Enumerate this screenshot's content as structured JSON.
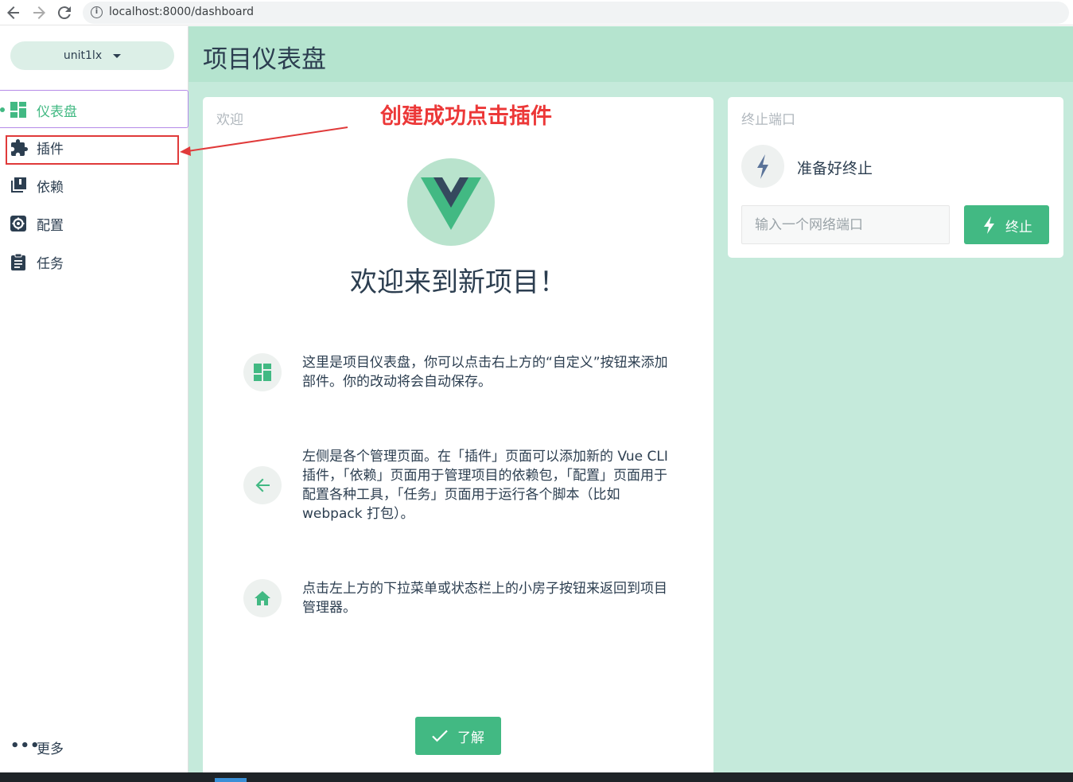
{
  "browser": {
    "url": "localhost:8000/dashboard",
    "back_icon": "arrow-left-icon",
    "forward_icon": "arrow-right-icon",
    "reload_icon": "reload-icon"
  },
  "sidebar": {
    "project_name": "unit1lx",
    "items": [
      {
        "label": "仪表盘",
        "icon": "dashboard-icon",
        "active": true
      },
      {
        "label": "插件",
        "icon": "puzzle-icon"
      },
      {
        "label": "依赖",
        "icon": "books-icon"
      },
      {
        "label": "配置",
        "icon": "gear-icon"
      },
      {
        "label": "任务",
        "icon": "clipboard-icon"
      }
    ],
    "more_label": "更多"
  },
  "header": {
    "title": "项目仪表盘"
  },
  "welcome": {
    "card_title": "欢迎",
    "heading": "欢迎来到新项目！",
    "tips": [
      {
        "icon": "dashboard-icon",
        "text": "这里是项目仪表盘，你可以点击右上方的“自定义”按钮来添加部件。你的改动将会自动保存。"
      },
      {
        "icon": "arrow-left-icon",
        "text": "左侧是各个管理页面。在「插件」页面可以添加新的 Vue CLI 插件，「依赖」页面用于管理项目的依赖包，「配置」页面用于配置各种工具，「任务」页面用于运行各个脚本（比如 webpack 打包）。"
      },
      {
        "icon": "home-icon",
        "text": "点击左上方的下拉菜单或状态栏上的小房子按钮来返回到项目管理器。"
      }
    ],
    "ok_label": "了解"
  },
  "kill_port": {
    "card_title": "终止端口",
    "status": "准备好终止",
    "input_placeholder": "输入一个网络端口",
    "button_label": "终止"
  },
  "annotation": {
    "text": "创建成功点击插件",
    "color": "#ec3838"
  },
  "colors": {
    "accent": "#42b983",
    "main_bg": "#c5eadb",
    "header_bg": "#b5e4cf"
  }
}
